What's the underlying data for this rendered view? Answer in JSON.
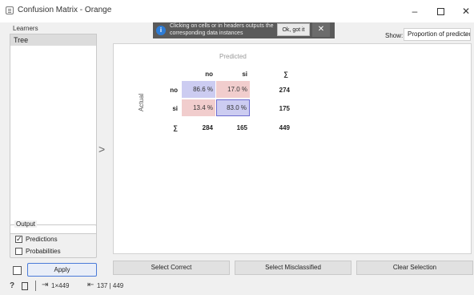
{
  "window": {
    "title": "Confusion Matrix - Orange",
    "minimize": "–",
    "close": "✕"
  },
  "sidebar": {
    "learners_label": "Learners",
    "learners": [
      "Tree"
    ],
    "output_label": "Output",
    "predictions_label": "Predictions",
    "predictions_checked": true,
    "probabilities_label": "Probabilities",
    "probabilities_checked": false,
    "apply_label": "Apply",
    "apply_auto_checked": false
  },
  "notification": {
    "icon": "info-icon",
    "text": "Clicking on cells or in headers outputs the corresponding data instances",
    "ok_label": "Ok, got it",
    "close_label": "✕"
  },
  "show": {
    "label": "Show:",
    "selected": "Proportion of predicted"
  },
  "matrix": {
    "predicted_label": "Predicted",
    "actual_label": "Actual",
    "sum_symbol": "∑",
    "columns": [
      "no",
      "si"
    ],
    "rows": [
      {
        "label": "no",
        "cells": [
          "86.6 %",
          "17.0 %"
        ],
        "total": "274"
      },
      {
        "label": "si",
        "cells": [
          "13.4 %",
          "83.0 %"
        ],
        "total": "175"
      }
    ],
    "column_totals": [
      "284",
      "165"
    ],
    "grand_total": "449",
    "colors": {
      "diagonal": "#ccccf1",
      "off_diagonal": "#f1cdcd"
    }
  },
  "buttons": {
    "select_correct": "Select Correct",
    "select_misclassified": "Select Misclassified",
    "clear_selection": "Clear Selection"
  },
  "statusbar": {
    "help": "?",
    "input_summary": "1×449",
    "output_summary": "137 | 449"
  }
}
